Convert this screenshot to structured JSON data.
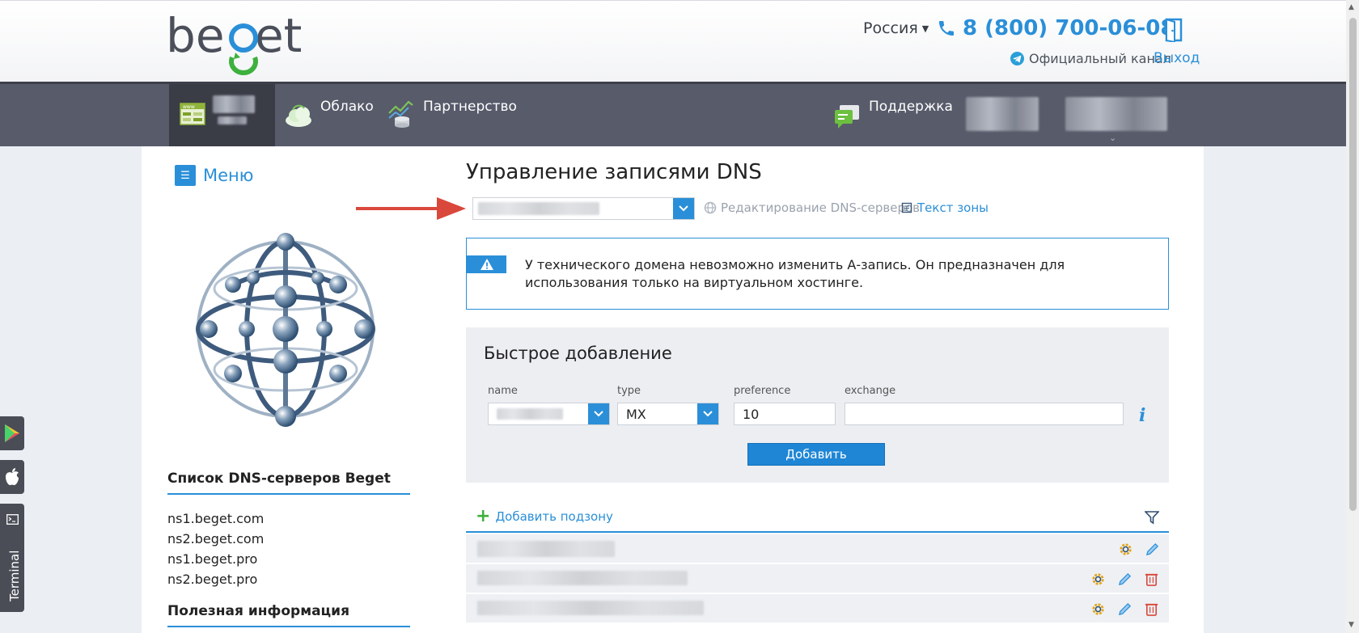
{
  "header": {
    "logo_text": "beget",
    "region": "Россия",
    "phone": "8 (800) 700-06-08",
    "official_channel": "Официальный канал",
    "logout": "Выход"
  },
  "nav": {
    "items": [
      {
        "label": ""
      },
      {
        "label": "Облако"
      },
      {
        "label": "Партнерство"
      },
      {
        "label": "Поддержка"
      }
    ]
  },
  "sidebar": {
    "menu_label": "Меню",
    "dns_servers_title": "Список DNS-серверов Beget",
    "dns_servers": [
      "ns1.beget.com",
      "ns2.beget.com",
      "ns1.beget.pro",
      "ns2.beget.pro"
    ],
    "useful_info_title": "Полезная информация"
  },
  "main": {
    "title": "Управление записями DNS",
    "edit_dns_servers": "Редактирование DNS-серверов",
    "zone_text": "Текст зоны",
    "notice": "У технического домена невозможно изменить А-запись. Он предназначен для использования только на виртуальном хостинге.",
    "quick_add": {
      "title": "Быстрое добавление",
      "labels": {
        "name": "name",
        "type": "type",
        "preference": "preference",
        "exchange": "exchange"
      },
      "type_value": "MX",
      "preference_value": "10",
      "exchange_value": "",
      "add_button": "Добавить"
    },
    "add_subzone": "Добавить подзону"
  },
  "floating": {
    "terminal": "Terminal"
  },
  "colors": {
    "accent": "#2a8fd8",
    "nav_bg": "#575b6a",
    "arrow": "#d9483b"
  }
}
